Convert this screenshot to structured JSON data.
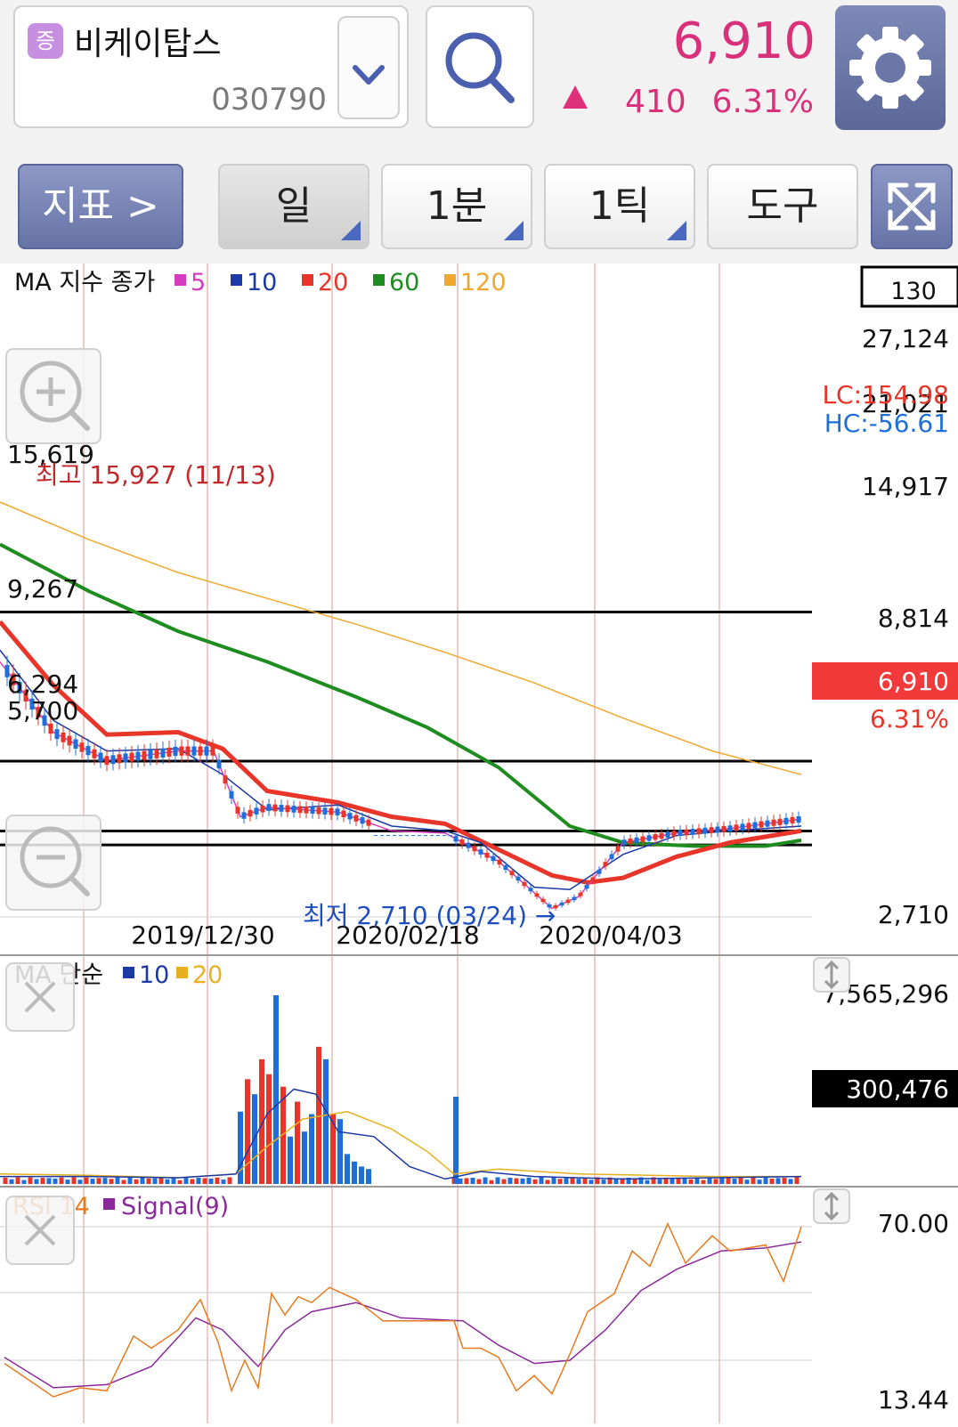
{
  "header": {
    "badge": "증",
    "stock_name": "비케이탑스",
    "stock_code": "030790",
    "price": "6,910",
    "change": "410",
    "change_pct": "6.31%",
    "up_color": "#d9307a"
  },
  "toolbar": {
    "indicator_label": "지표 >",
    "period_day": "일",
    "period_min": "1분",
    "period_tick": "1틱",
    "tools": "도구"
  },
  "icons": [
    "search-icon",
    "gear-icon",
    "chevron-down-icon",
    "expand-icon",
    "zoom-in-icon",
    "zoom-out-icon",
    "close-icon",
    "resize-icon"
  ],
  "chart_data": [
    {
      "type": "candlestick",
      "title": "MA 지수 종가",
      "legend": [
        {
          "name": "5",
          "color": "#d63cc0"
        },
        {
          "name": "10",
          "color": "#1b3aa6"
        },
        {
          "name": "20",
          "color": "#e8352a"
        },
        {
          "name": "60",
          "color": "#1e8c1e"
        },
        {
          "name": "120",
          "color": "#f0a830"
        }
      ],
      "count_box": "130",
      "y_ticks": [
        "27,124",
        "21,021",
        "14,917",
        "8,814",
        "2,710"
      ],
      "ylim": [
        2710,
        27124
      ],
      "x_labels": [
        "2019/12/30",
        "2020/02/18",
        "2020/04/03"
      ],
      "current_price_label": "6,910",
      "current_pct_label": "6.31%",
      "lc_label": "LC:154.98",
      "hc_label": "HC:-56.61",
      "hlines": [
        {
          "label": "15,619",
          "value": 15619
        },
        {
          "label": "9,267",
          "value": 9267
        },
        {
          "label": "6,294",
          "value": 6294
        },
        {
          "label": "5,700",
          "value": 5700
        }
      ],
      "high_annotation": "최고 15,927 (11/13)",
      "low_annotation": "최저 2,710 (03/24) →",
      "ma120": [
        [
          0,
          20300
        ],
        [
          100,
          18700
        ],
        [
          200,
          17300
        ],
        [
          300,
          16200
        ],
        [
          400,
          15100
        ],
        [
          500,
          13900
        ],
        [
          600,
          12600
        ],
        [
          700,
          11100
        ],
        [
          800,
          9700
        ],
        [
          900,
          8700
        ]
      ],
      "ma60": [
        [
          0,
          18500
        ],
        [
          100,
          16500
        ],
        [
          200,
          14800
        ],
        [
          300,
          13500
        ],
        [
          400,
          12000
        ],
        [
          480,
          10700
        ],
        [
          560,
          9000
        ],
        [
          640,
          6500
        ],
        [
          700,
          5800
        ],
        [
          780,
          5650
        ],
        [
          860,
          5650
        ],
        [
          900,
          5900
        ]
      ],
      "ma20": [
        [
          0,
          15200
        ],
        [
          60,
          12500
        ],
        [
          120,
          10400
        ],
        [
          200,
          10500
        ],
        [
          250,
          9800
        ],
        [
          300,
          8000
        ],
        [
          380,
          7500
        ],
        [
          440,
          6900
        ],
        [
          500,
          6600
        ],
        [
          560,
          5500
        ],
        [
          620,
          4400
        ],
        [
          660,
          4100
        ],
        [
          700,
          4300
        ],
        [
          760,
          5200
        ],
        [
          820,
          5800
        ],
        [
          900,
          6300
        ]
      ],
      "ma10": [
        [
          0,
          14000
        ],
        [
          60,
          11000
        ],
        [
          120,
          9700
        ],
        [
          200,
          9800
        ],
        [
          250,
          8700
        ],
        [
          300,
          7200
        ],
        [
          380,
          7400
        ],
        [
          440,
          6500
        ],
        [
          500,
          6300
        ],
        [
          540,
          5800
        ],
        [
          600,
          3900
        ],
        [
          640,
          3800
        ],
        [
          700,
          5300
        ],
        [
          760,
          6100
        ],
        [
          820,
          6300
        ],
        [
          900,
          6500
        ]
      ],
      "ma5": [
        [
          0,
          13500
        ],
        [
          60,
          10500
        ],
        [
          120,
          9300
        ],
        [
          200,
          9700
        ],
        [
          240,
          9700
        ],
        [
          270,
          6900
        ],
        [
          300,
          7300
        ],
        [
          380,
          7100
        ],
        [
          440,
          6300
        ],
        [
          500,
          6200
        ],
        [
          560,
          5000
        ],
        [
          620,
          3000
        ],
        [
          650,
          3500
        ],
        [
          700,
          5800
        ],
        [
          760,
          6200
        ],
        [
          820,
          6400
        ],
        [
          900,
          6800
        ]
      ]
    },
    {
      "type": "bar",
      "title": "MA 단순",
      "legend": [
        {
          "name": "10",
          "color": "#1b3aa6"
        },
        {
          "name": "20",
          "color": "#e8b020"
        }
      ],
      "y_ticks": [
        "7,565,296"
      ],
      "current_label": "300,476",
      "ylim": [
        0,
        7565296
      ],
      "bars_large": [
        {
          "x": 270,
          "value": 2900000,
          "color": "#1e6fd9"
        },
        {
          "x": 278,
          "value": 4200000,
          "color": "#e8352a"
        },
        {
          "x": 286,
          "value": 3600000,
          "color": "#1e6fd9"
        },
        {
          "x": 294,
          "value": 5000000,
          "color": "#e8352a"
        },
        {
          "x": 302,
          "value": 4400000,
          "color": "#e8352a"
        },
        {
          "x": 310,
          "value": 7565296,
          "color": "#1e6fd9"
        },
        {
          "x": 318,
          "value": 3900000,
          "color": "#e8352a"
        },
        {
          "x": 326,
          "value": 1900000,
          "color": "#1e6fd9"
        },
        {
          "x": 334,
          "value": 3300000,
          "color": "#e8352a"
        },
        {
          "x": 342,
          "value": 2100000,
          "color": "#1e6fd9"
        },
        {
          "x": 350,
          "value": 2800000,
          "color": "#1e6fd9"
        },
        {
          "x": 358,
          "value": 5500000,
          "color": "#e8352a"
        },
        {
          "x": 366,
          "value": 5000000,
          "color": "#1e6fd9"
        },
        {
          "x": 374,
          "value": 2800000,
          "color": "#e8352a"
        },
        {
          "x": 382,
          "value": 2600000,
          "color": "#1e6fd9"
        },
        {
          "x": 390,
          "value": 1200000,
          "color": "#1e6fd9"
        },
        {
          "x": 398,
          "value": 900000,
          "color": "#1e6fd9"
        },
        {
          "x": 406,
          "value": 700000,
          "color": "#1e6fd9"
        },
        {
          "x": 414,
          "value": 600000,
          "color": "#1e6fd9"
        },
        {
          "x": 512,
          "value": 3500000,
          "color": "#1e6fd9"
        }
      ],
      "vol_ma10": [
        [
          0,
          300000
        ],
        [
          100,
          300000
        ],
        [
          200,
          250000
        ],
        [
          265,
          400000
        ],
        [
          300,
          2800000
        ],
        [
          330,
          3800000
        ],
        [
          355,
          3600000
        ],
        [
          380,
          2100000
        ],
        [
          420,
          1900000
        ],
        [
          460,
          700000
        ],
        [
          500,
          200000
        ],
        [
          540,
          500000
        ],
        [
          600,
          300000
        ],
        [
          700,
          200000
        ],
        [
          800,
          250000
        ],
        [
          900,
          300000
        ]
      ],
      "vol_ma20": [
        [
          0,
          400000
        ],
        [
          100,
          350000
        ],
        [
          200,
          250000
        ],
        [
          265,
          400000
        ],
        [
          300,
          1500000
        ],
        [
          340,
          2600000
        ],
        [
          390,
          2900000
        ],
        [
          440,
          2200000
        ],
        [
          480,
          1300000
        ],
        [
          510,
          400000
        ],
        [
          560,
          600000
        ],
        [
          650,
          400000
        ],
        [
          800,
          300000
        ],
        [
          900,
          300000
        ]
      ]
    },
    {
      "type": "line",
      "title": "RSI 14",
      "legend": [
        {
          "name": "RSI 14",
          "color": "#e87a1e"
        },
        {
          "name": "Signal(9)",
          "color": "#8a2a9a"
        }
      ],
      "y_ticks": [
        "70.00",
        "13.44"
      ],
      "ylim": [
        13.44,
        70
      ],
      "rsi": [
        [
          5,
          25
        ],
        [
          40,
          18
        ],
        [
          60,
          14
        ],
        [
          90,
          17
        ],
        [
          120,
          16
        ],
        [
          150,
          34
        ],
        [
          170,
          30
        ],
        [
          200,
          36
        ],
        [
          225,
          46
        ],
        [
          245,
          32
        ],
        [
          260,
          16
        ],
        [
          275,
          26
        ],
        [
          290,
          17
        ],
        [
          305,
          48
        ],
        [
          320,
          41
        ],
        [
          335,
          47
        ],
        [
          350,
          45
        ],
        [
          370,
          50
        ],
        [
          400,
          46
        ],
        [
          430,
          39
        ],
        [
          510,
          39
        ],
        [
          520,
          30
        ],
        [
          540,
          30
        ],
        [
          560,
          27
        ],
        [
          580,
          16
        ],
        [
          600,
          21
        ],
        [
          620,
          15
        ],
        [
          640,
          28
        ],
        [
          660,
          42
        ],
        [
          690,
          48
        ],
        [
          710,
          62
        ],
        [
          730,
          57
        ],
        [
          750,
          71
        ],
        [
          770,
          58
        ],
        [
          800,
          67
        ],
        [
          820,
          62
        ],
        [
          860,
          64
        ],
        [
          880,
          52
        ],
        [
          900,
          70
        ]
      ],
      "signal": [
        [
          5,
          27
        ],
        [
          60,
          17
        ],
        [
          120,
          18
        ],
        [
          170,
          24
        ],
        [
          220,
          40
        ],
        [
          250,
          36
        ],
        [
          290,
          24
        ],
        [
          320,
          36
        ],
        [
          350,
          42
        ],
        [
          400,
          45
        ],
        [
          450,
          40
        ],
        [
          520,
          39
        ],
        [
          560,
          31
        ],
        [
          600,
          25
        ],
        [
          640,
          26
        ],
        [
          680,
          36
        ],
        [
          720,
          49
        ],
        [
          760,
          56
        ],
        [
          810,
          62
        ],
        [
          860,
          63
        ],
        [
          900,
          65
        ]
      ]
    }
  ]
}
